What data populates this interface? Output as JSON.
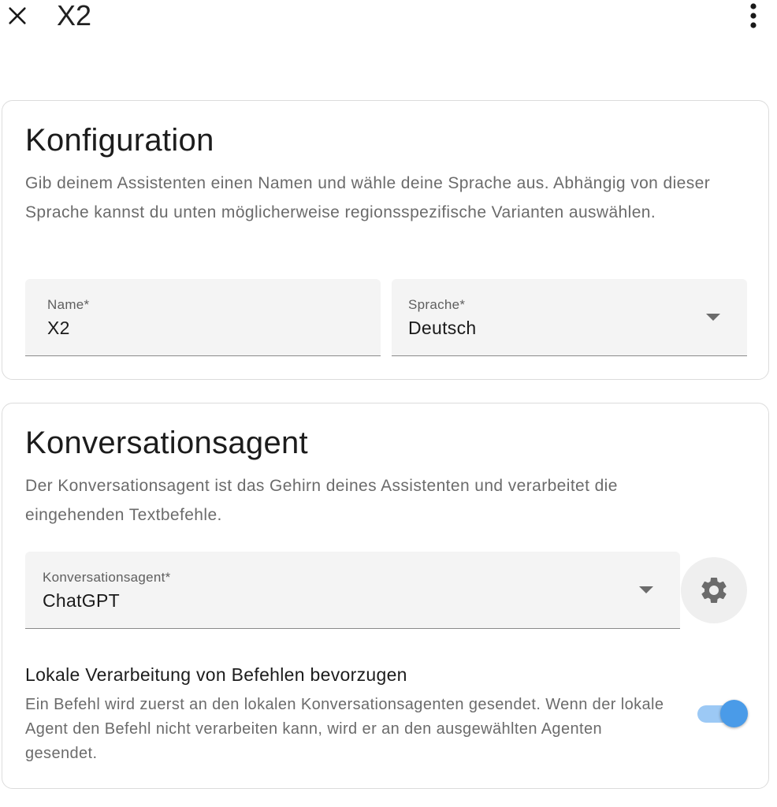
{
  "header": {
    "title": "X2",
    "close_icon": "close-icon",
    "menu_icon": "more-vertical-icon"
  },
  "configuration": {
    "title": "Konfiguration",
    "description": "Gib deinem Assistenten einen Namen und wähle deine Sprache aus. Abhängig von dieser Sprache kannst du unten möglicherweise regionsspezifische Varianten auswählen.",
    "name_field": {
      "label": "Name*",
      "value": "X2"
    },
    "language_field": {
      "label": "Sprache*",
      "value": "Deutsch"
    }
  },
  "conversation_agent": {
    "title": "Konversationsagent",
    "description": "Der Konversationsagent ist das Gehirn deines Assistenten und verarbeitet die eingehenden Textbefehle.",
    "agent_field": {
      "label": "Konversationsagent*",
      "value": "ChatGPT"
    },
    "settings_icon": "gear-icon",
    "prefer_local": {
      "title": "Lokale Verarbeitung von Befehlen bevorzugen",
      "description": "Ein Befehl wird zuerst an den lokalen Konversationsagenten gesendet. Wenn der lokale Agent den Befehl nicht verarbeiten kann, wird er an den ausgewählten Agenten gesendet.",
      "enabled": true
    }
  },
  "colors": {
    "accent": "#4a9be8",
    "accent_track": "#9cc9f5",
    "field_bg": "#f4f4f4",
    "card_border": "#dcdcdc",
    "secondary_text": "#6b6b6b"
  }
}
